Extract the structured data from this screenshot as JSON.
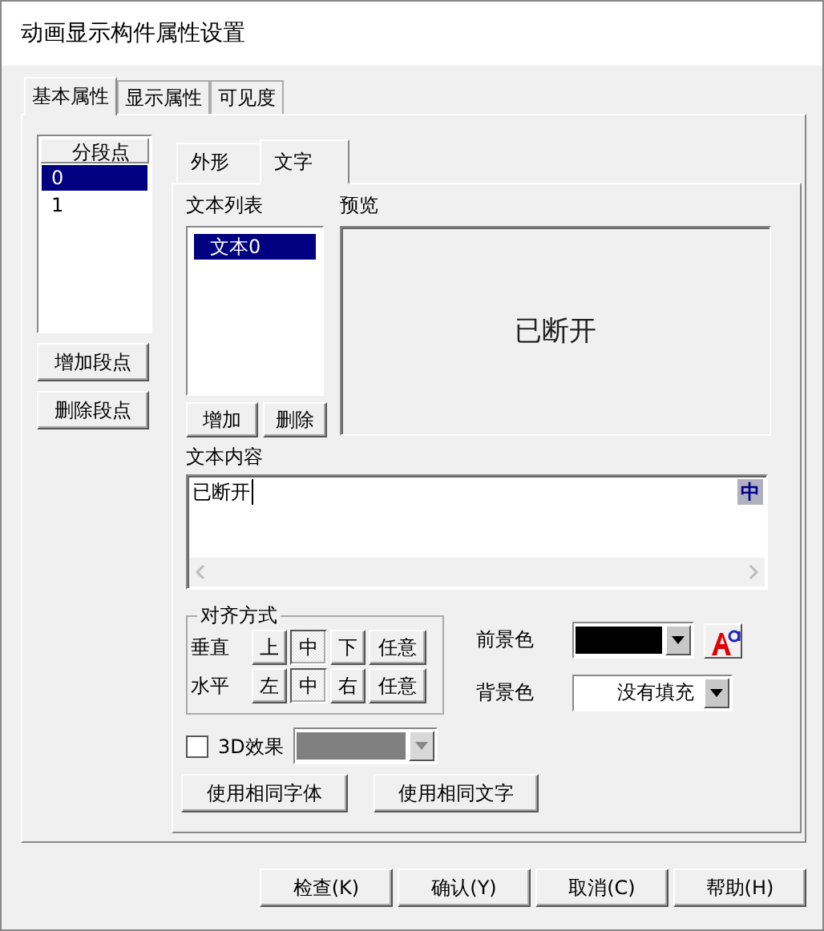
{
  "window": {
    "title": "动画显示构件属性设置"
  },
  "tabs": [
    {
      "label": "基本属性",
      "selected": true
    },
    {
      "label": "显示属性",
      "selected": false
    },
    {
      "label": "可见度",
      "selected": false
    }
  ],
  "segments": {
    "header": "分段点",
    "items": [
      {
        "label": "0",
        "selected": true
      },
      {
        "label": "1",
        "selected": false
      }
    ],
    "buttons": [
      "增加段点",
      "删除段点"
    ]
  },
  "inner_tabs": [
    {
      "label": "外形",
      "selected": false
    },
    {
      "label": "文字",
      "selected": true
    }
  ],
  "text_list": {
    "label": "文本列表",
    "items": [
      {
        "label": "文本0",
        "selected": true
      }
    ],
    "buttons": [
      "增加",
      "删除"
    ]
  },
  "preview": {
    "label": "预览",
    "text": "已断开"
  },
  "text_content": {
    "label": "文本内容",
    "value": "已断开",
    "ime_indicator": "中"
  },
  "alignment": {
    "title": "对齐方式",
    "rows": [
      {
        "label": "垂直",
        "options": [
          {
            "label": "上",
            "selected": false
          },
          {
            "label": "中",
            "selected": true
          },
          {
            "label": "下",
            "selected": false
          },
          {
            "label": "任意",
            "selected": false
          }
        ]
      },
      {
        "label": "水平",
        "options": [
          {
            "label": "左",
            "selected": false
          },
          {
            "label": "中",
            "selected": true
          },
          {
            "label": "右",
            "selected": false
          },
          {
            "label": "任意",
            "selected": false
          }
        ]
      }
    ]
  },
  "foreground": {
    "label": "前景色",
    "color": "#000000"
  },
  "background": {
    "label": "背景色",
    "value": "没有填充"
  },
  "effect_3d": {
    "label": "3D效果",
    "checked": false,
    "color": "#808080"
  },
  "same_buttons": [
    "使用相同字体",
    "使用相同文字"
  ],
  "footer_buttons": [
    "检查(K)",
    "确认(Y)",
    "取消(C)",
    "帮助(H)"
  ]
}
